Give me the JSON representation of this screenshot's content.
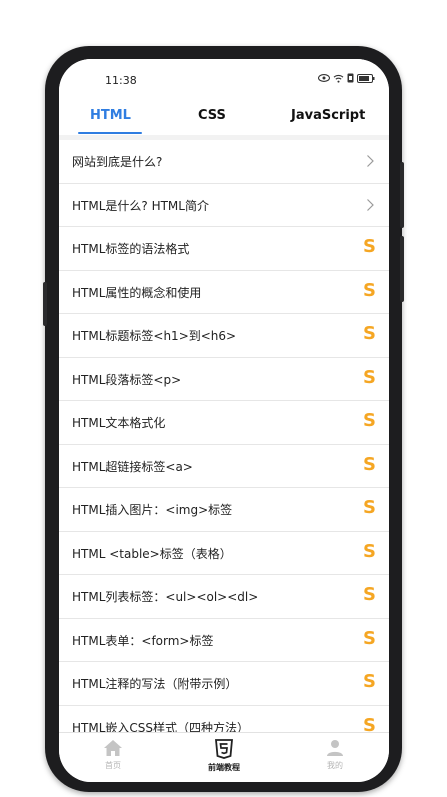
{
  "status_bar": {
    "time": "11:38"
  },
  "tabs": [
    {
      "label": "HTML"
    },
    {
      "label": "CSS"
    },
    {
      "label": "JavaScript"
    }
  ],
  "list_items": [
    {
      "label": "网站到底是什么?",
      "trailing": "chevron"
    },
    {
      "label": "HTML是什么? HTML简介",
      "trailing": "chevron"
    },
    {
      "label": "HTML标签的语法格式",
      "trailing": "s-badge"
    },
    {
      "label": "HTML属性的概念和使用",
      "trailing": "s-badge"
    },
    {
      "label": "HTML标题标签<h1>到<h6>",
      "trailing": "s-badge"
    },
    {
      "label": "HTML段落标签<p>",
      "trailing": "s-badge"
    },
    {
      "label": "HTML文本格式化",
      "trailing": "s-badge"
    },
    {
      "label": "HTML超链接标签<a>",
      "trailing": "s-badge"
    },
    {
      "label": "HTML插入图片：<img>标签",
      "trailing": "s-badge"
    },
    {
      "label": "HTML <table>标签（表格）",
      "trailing": "s-badge"
    },
    {
      "label": "HTML列表标签：<ul><ol><dl>",
      "trailing": "s-badge"
    },
    {
      "label": "HTML表单：<form>标签",
      "trailing": "s-badge"
    },
    {
      "label": "HTML注释的写法（附带示例）",
      "trailing": "s-badge"
    },
    {
      "label": "HTML嵌入CSS样式（四种方法）",
      "trailing": "s-badge"
    }
  ],
  "s_badge_glyph": "S",
  "bottom_nav": [
    {
      "label": "首页",
      "icon": "home-icon"
    },
    {
      "label": "前端教程",
      "icon": "html5-icon"
    },
    {
      "label": "我的",
      "icon": "user-icon"
    }
  ],
  "colors": {
    "accent": "#2f7de1",
    "badge": "#f5a623"
  }
}
